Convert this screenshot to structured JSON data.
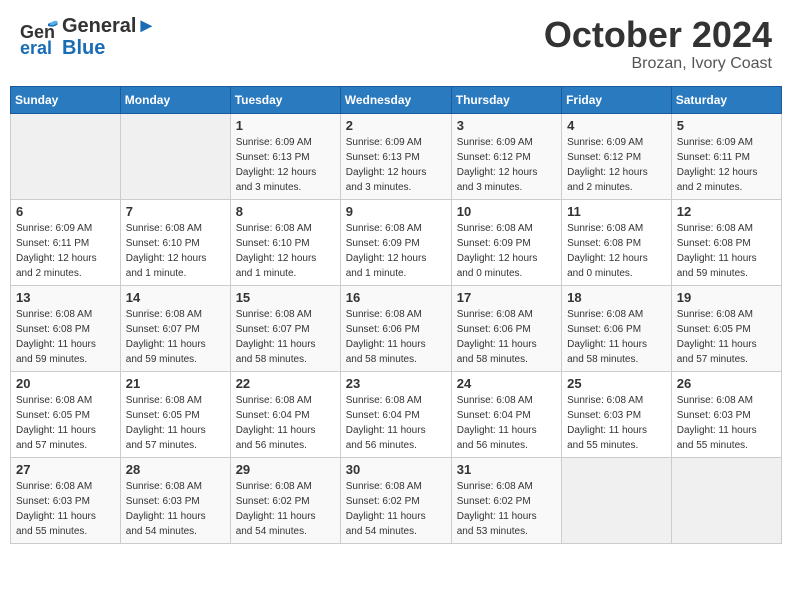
{
  "header": {
    "logo_line1": "General",
    "logo_line2": "Blue",
    "month": "October 2024",
    "location": "Brozan, Ivory Coast"
  },
  "weekdays": [
    "Sunday",
    "Monday",
    "Tuesday",
    "Wednesday",
    "Thursday",
    "Friday",
    "Saturday"
  ],
  "weeks": [
    [
      {
        "day": "",
        "info": ""
      },
      {
        "day": "",
        "info": ""
      },
      {
        "day": "1",
        "info": "Sunrise: 6:09 AM\nSunset: 6:13 PM\nDaylight: 12 hours\nand 3 minutes."
      },
      {
        "day": "2",
        "info": "Sunrise: 6:09 AM\nSunset: 6:13 PM\nDaylight: 12 hours\nand 3 minutes."
      },
      {
        "day": "3",
        "info": "Sunrise: 6:09 AM\nSunset: 6:12 PM\nDaylight: 12 hours\nand 3 minutes."
      },
      {
        "day": "4",
        "info": "Sunrise: 6:09 AM\nSunset: 6:12 PM\nDaylight: 12 hours\nand 2 minutes."
      },
      {
        "day": "5",
        "info": "Sunrise: 6:09 AM\nSunset: 6:11 PM\nDaylight: 12 hours\nand 2 minutes."
      }
    ],
    [
      {
        "day": "6",
        "info": "Sunrise: 6:09 AM\nSunset: 6:11 PM\nDaylight: 12 hours\nand 2 minutes."
      },
      {
        "day": "7",
        "info": "Sunrise: 6:08 AM\nSunset: 6:10 PM\nDaylight: 12 hours\nand 1 minute."
      },
      {
        "day": "8",
        "info": "Sunrise: 6:08 AM\nSunset: 6:10 PM\nDaylight: 12 hours\nand 1 minute."
      },
      {
        "day": "9",
        "info": "Sunrise: 6:08 AM\nSunset: 6:09 PM\nDaylight: 12 hours\nand 1 minute."
      },
      {
        "day": "10",
        "info": "Sunrise: 6:08 AM\nSunset: 6:09 PM\nDaylight: 12 hours\nand 0 minutes."
      },
      {
        "day": "11",
        "info": "Sunrise: 6:08 AM\nSunset: 6:08 PM\nDaylight: 12 hours\nand 0 minutes."
      },
      {
        "day": "12",
        "info": "Sunrise: 6:08 AM\nSunset: 6:08 PM\nDaylight: 11 hours\nand 59 minutes."
      }
    ],
    [
      {
        "day": "13",
        "info": "Sunrise: 6:08 AM\nSunset: 6:08 PM\nDaylight: 11 hours\nand 59 minutes."
      },
      {
        "day": "14",
        "info": "Sunrise: 6:08 AM\nSunset: 6:07 PM\nDaylight: 11 hours\nand 59 minutes."
      },
      {
        "day": "15",
        "info": "Sunrise: 6:08 AM\nSunset: 6:07 PM\nDaylight: 11 hours\nand 58 minutes."
      },
      {
        "day": "16",
        "info": "Sunrise: 6:08 AM\nSunset: 6:06 PM\nDaylight: 11 hours\nand 58 minutes."
      },
      {
        "day": "17",
        "info": "Sunrise: 6:08 AM\nSunset: 6:06 PM\nDaylight: 11 hours\nand 58 minutes."
      },
      {
        "day": "18",
        "info": "Sunrise: 6:08 AM\nSunset: 6:06 PM\nDaylight: 11 hours\nand 58 minutes."
      },
      {
        "day": "19",
        "info": "Sunrise: 6:08 AM\nSunset: 6:05 PM\nDaylight: 11 hours\nand 57 minutes."
      }
    ],
    [
      {
        "day": "20",
        "info": "Sunrise: 6:08 AM\nSunset: 6:05 PM\nDaylight: 11 hours\nand 57 minutes."
      },
      {
        "day": "21",
        "info": "Sunrise: 6:08 AM\nSunset: 6:05 PM\nDaylight: 11 hours\nand 57 minutes."
      },
      {
        "day": "22",
        "info": "Sunrise: 6:08 AM\nSunset: 6:04 PM\nDaylight: 11 hours\nand 56 minutes."
      },
      {
        "day": "23",
        "info": "Sunrise: 6:08 AM\nSunset: 6:04 PM\nDaylight: 11 hours\nand 56 minutes."
      },
      {
        "day": "24",
        "info": "Sunrise: 6:08 AM\nSunset: 6:04 PM\nDaylight: 11 hours\nand 56 minutes."
      },
      {
        "day": "25",
        "info": "Sunrise: 6:08 AM\nSunset: 6:03 PM\nDaylight: 11 hours\nand 55 minutes."
      },
      {
        "day": "26",
        "info": "Sunrise: 6:08 AM\nSunset: 6:03 PM\nDaylight: 11 hours\nand 55 minutes."
      }
    ],
    [
      {
        "day": "27",
        "info": "Sunrise: 6:08 AM\nSunset: 6:03 PM\nDaylight: 11 hours\nand 55 minutes."
      },
      {
        "day": "28",
        "info": "Sunrise: 6:08 AM\nSunset: 6:03 PM\nDaylight: 11 hours\nand 54 minutes."
      },
      {
        "day": "29",
        "info": "Sunrise: 6:08 AM\nSunset: 6:02 PM\nDaylight: 11 hours\nand 54 minutes."
      },
      {
        "day": "30",
        "info": "Sunrise: 6:08 AM\nSunset: 6:02 PM\nDaylight: 11 hours\nand 54 minutes."
      },
      {
        "day": "31",
        "info": "Sunrise: 6:08 AM\nSunset: 6:02 PM\nDaylight: 11 hours\nand 53 minutes."
      },
      {
        "day": "",
        "info": ""
      },
      {
        "day": "",
        "info": ""
      }
    ]
  ]
}
